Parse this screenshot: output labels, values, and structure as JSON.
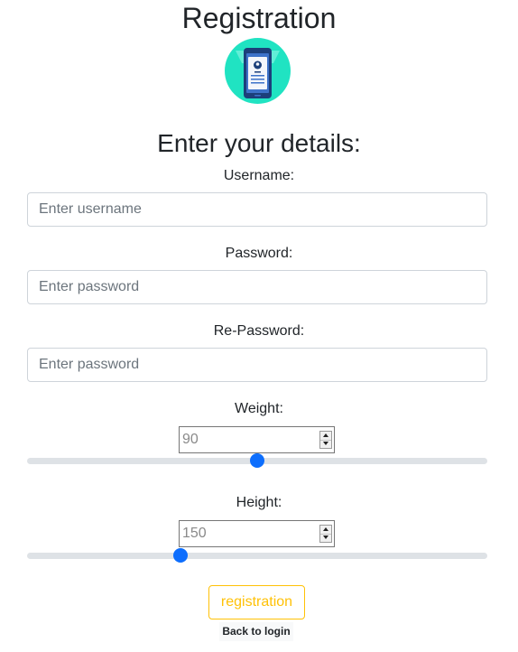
{
  "page": {
    "title": "Registration",
    "subtitle": "Enter your details:"
  },
  "form": {
    "username": {
      "label": "Username:",
      "placeholder": "Enter username",
      "value": ""
    },
    "password": {
      "label": "Password:",
      "placeholder": "Enter password",
      "value": ""
    },
    "repassword": {
      "label": "Re-Password:",
      "placeholder": "Enter password",
      "value": ""
    },
    "weight": {
      "label": "Weight:",
      "value": "90",
      "slider_fraction": 0.5
    },
    "height": {
      "label": "Height:",
      "value": "150",
      "slider_fraction": 0.3333
    }
  },
  "actions": {
    "register_label": "registration",
    "back_label": "Back to login"
  },
  "icons": {
    "logo": "phone-id-card-icon"
  },
  "colors": {
    "accent": "#0d6efd",
    "warning": "#ffc107",
    "logo_bg": "#20e3c2"
  }
}
